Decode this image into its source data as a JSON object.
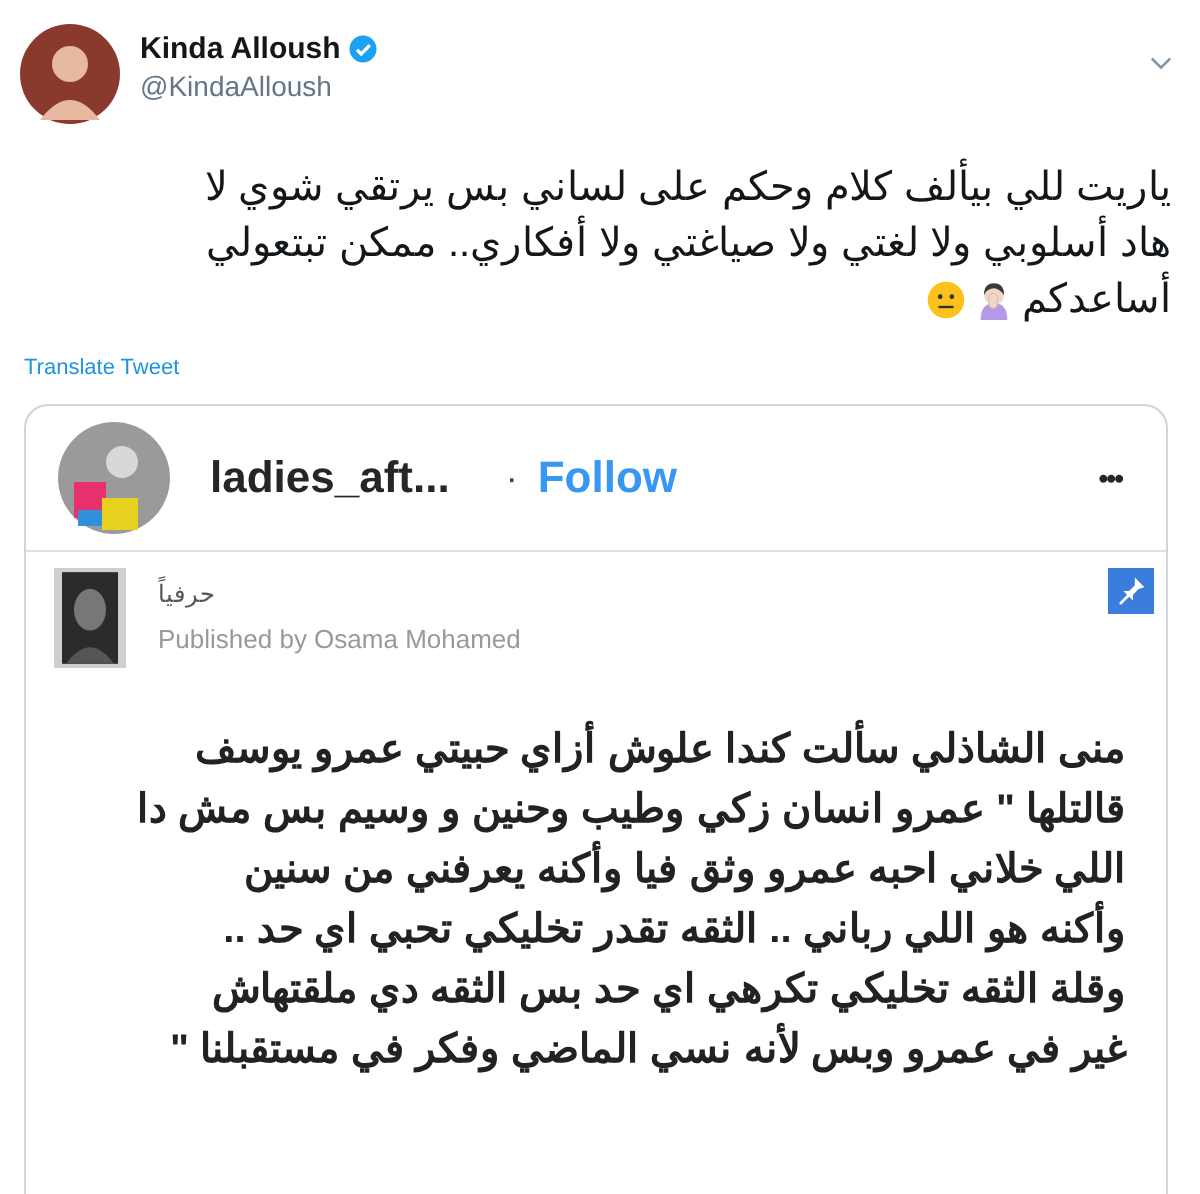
{
  "tweet": {
    "author": {
      "name": "Kinda Alloush",
      "handle": "@KindaAlloush",
      "verified": true
    },
    "text_lines": [
      "ياريت للي بيألف كلام وحكم على لساني بس يرتقي شوي لا",
      "هاد أسلوبي ولا لغتي ولا صياغتي ولا أفكاري.. ممكن تبتعولي",
      "أساعدكم"
    ],
    "translate": "Translate Tweet"
  },
  "embed": {
    "account": "ladies_aft...",
    "separator": "·",
    "follow": "Follow",
    "more": "•••",
    "article": {
      "title": "حرفياً",
      "byline": "Published by Osama Mohamed",
      "lines": [
        "منى الشاذلي سألت كندا علوش أزاي حبيتي عمرو يوسف",
        "قالتلها \" عمرو انسان زكي وطيب وحنين و وسيم بس مش دا",
        "اللي خلاني احبه عمرو وثق فيا وأكنه يعرفني من سنين",
        "وأكنه هو اللي رباني .. الثقه تقدر تخليكي تحبي اي حد ..",
        "وقلة الثقه تخليكي تكرهي اي حد بس الثقه دي ملقتهاش",
        "غير في عمرو وبس لأنه نسي الماضي وفكر في مستقبلنا \""
      ]
    }
  }
}
